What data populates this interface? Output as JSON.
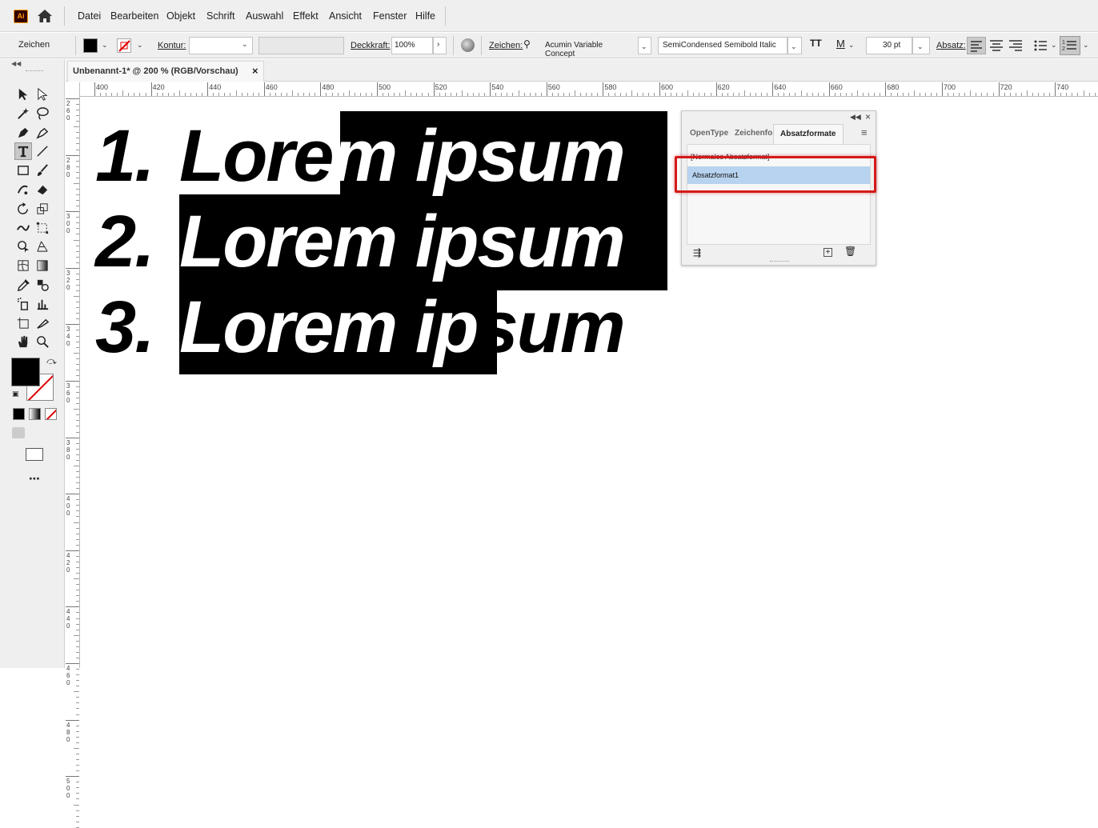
{
  "app": {
    "logo": "Ai",
    "home_icon": "home-icon"
  },
  "menu": [
    "Datei",
    "Bearbeiten",
    "Objekt",
    "Schrift",
    "Auswahl",
    "Effekt",
    "Ansicht",
    "Fenster",
    "Hilfe"
  ],
  "control": {
    "selection_label": "Zeichen",
    "stroke_label": "Kontur:",
    "opacity_label": "Deckkraft:",
    "opacity_value": "100%",
    "character_label": "Zeichen:",
    "font_family": "Acumin Variable Concept",
    "font_style": "SemiCondensed Semibold Italic",
    "font_size": "30 pt",
    "paragraph_label": "Absatz:"
  },
  "document": {
    "tab_title": "Unbenannt-1* @ 200 % (RGB/Vorschau)",
    "close": "×"
  },
  "ruler": {
    "h_ticks": [
      "400",
      "420",
      "440",
      "460",
      "480",
      "500",
      "520",
      "540",
      "560",
      "580",
      "600",
      "620",
      "640",
      "660",
      "680",
      "700",
      "720",
      "740"
    ],
    "v_ticks": [
      "260",
      "280",
      "300",
      "320",
      "340",
      "360",
      "380",
      "400",
      "420",
      "440",
      "460",
      "480",
      "500"
    ]
  },
  "canvas": {
    "lines": [
      {
        "num": "1.",
        "text": "Lorem ipsum"
      },
      {
        "num": "2.",
        "text": "Lorem ipsum"
      },
      {
        "num": "3.",
        "text": "Lorem ipsum"
      }
    ]
  },
  "panel": {
    "tabs": [
      "OpenType",
      "Zeichenfo",
      "Absatzformate"
    ],
    "active_tab": "Absatzformate",
    "styles": [
      "[Normales Absatzformat]",
      "Absatzformat1"
    ],
    "selected_style": "Absatzformat1"
  },
  "colors": {
    "accent_highlight": "#d41a1a",
    "selection": "#b8d3ef",
    "ui_bg": "#efefef"
  }
}
